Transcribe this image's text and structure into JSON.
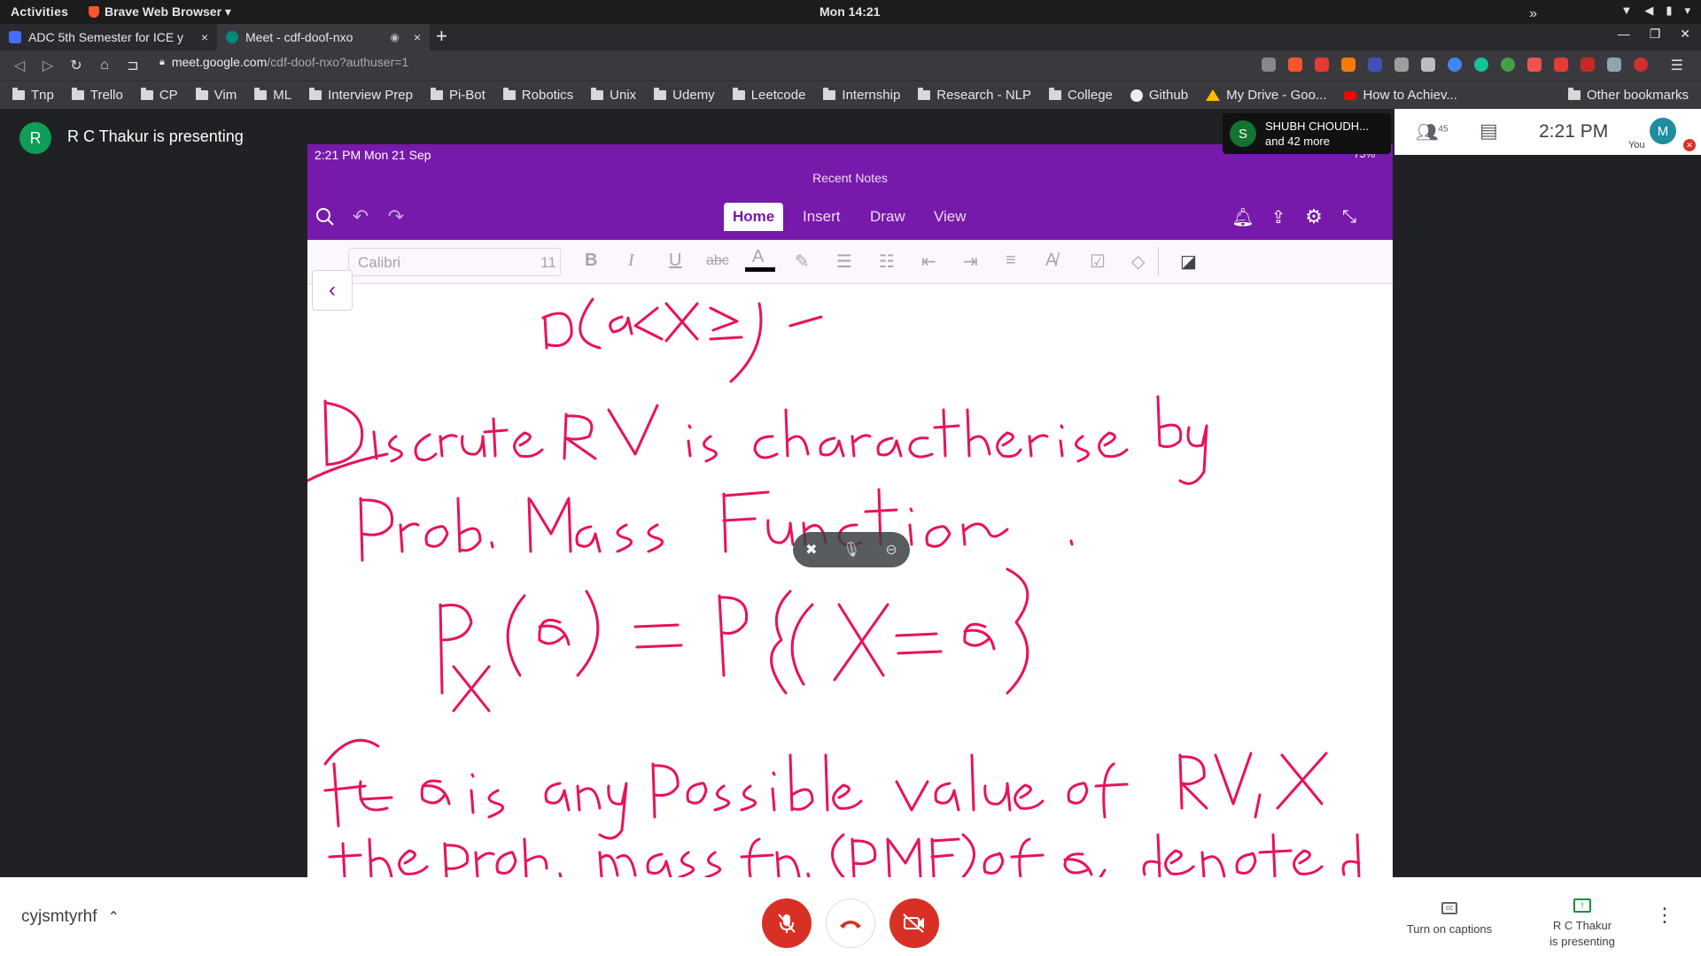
{
  "topbar": {
    "activities": "Activities",
    "app_name": "Brave Web Browser ▾",
    "clock": "Mon 14:21"
  },
  "tabs": [
    {
      "title": "ADC 5th Semester for ICE y",
      "close": "×"
    },
    {
      "title": "Meet - cdf-doof-nxo",
      "close": "×"
    }
  ],
  "newtab": "+",
  "address": {
    "host": "meet.google.com",
    "path": "/cdf-doof-nxo?authuser=1"
  },
  "bookmarks": [
    "Tnp",
    "Trello",
    "CP",
    "Vim",
    "ML",
    "Interview Prep",
    "Pi-Bot",
    "Robotics",
    "Unix",
    "Udemy",
    "Leetcode",
    "Internship",
    "Research - NLP",
    "College",
    "Github",
    "My Drive - Goo...",
    "How to Achiev..."
  ],
  "bookmarks_more": "»",
  "bookmarks_other": "Other bookmarks",
  "meet": {
    "presenter_initial": "R",
    "presenter_text": "R C Thakur is presenting",
    "participant_initial": "S",
    "participant_name": "SHUBH CHOUDH...",
    "participant_more": "and 42 more",
    "people_count": "45",
    "time": "2:21 PM",
    "you_initial": "M",
    "you_label": "You",
    "meeting_code": "cyjsmtyrhf",
    "captions_label": "Turn on captions",
    "presenting_line1": "R C Thakur",
    "presenting_line2": "is presenting"
  },
  "ipad": {
    "status_time": "2:21 PM   Mon 21 Sep",
    "battery": "75%",
    "recent_notes": "Recent Notes",
    "tabs": [
      "Home",
      "Insert",
      "Draw",
      "View"
    ],
    "font_name": "Calibri",
    "font_size": "11"
  },
  "colors": {
    "onenote_purple": "#7719aa",
    "ink": "#e8125a",
    "meet_red": "#d93025"
  }
}
